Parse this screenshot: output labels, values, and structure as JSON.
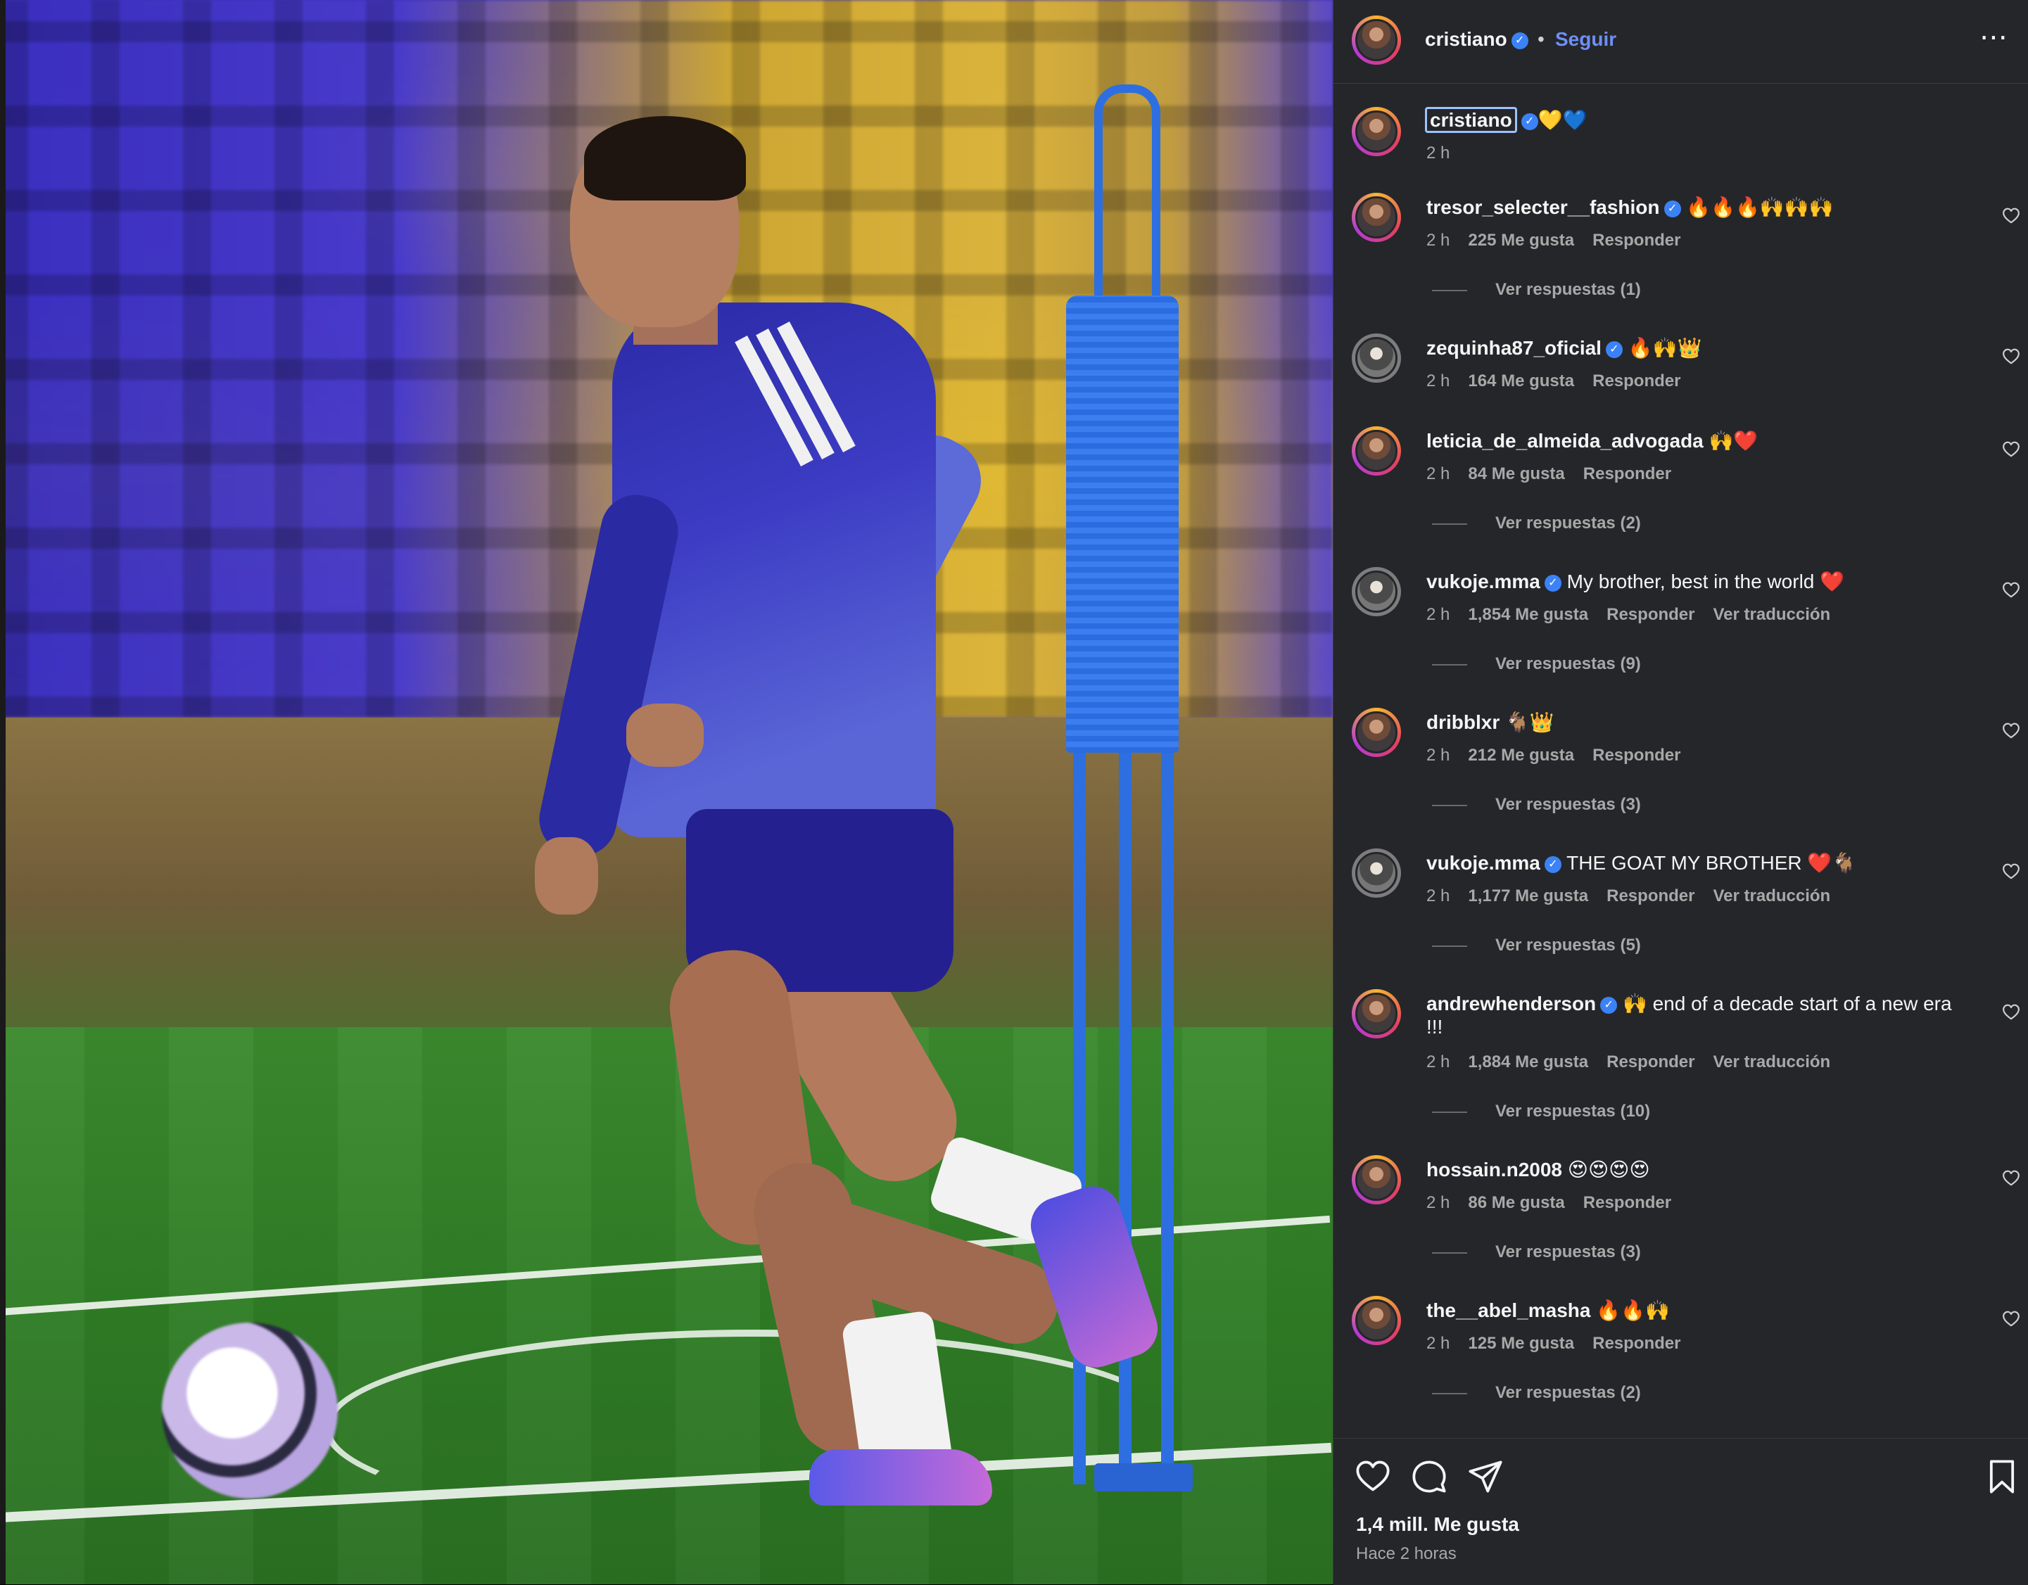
{
  "post": {
    "author": "cristiano",
    "follow_label": "Seguir",
    "dot": "•",
    "more": "⋯",
    "caption_user": "cristiano",
    "caption_text": "💛💙",
    "caption_time": "2 h"
  },
  "comments": [
    {
      "user": "tresor_selecter__fashion",
      "verified": true,
      "text": "🔥🔥🔥🙌🙌🙌",
      "time": "2 h",
      "likes": "225 Me gusta",
      "reply": "Responder",
      "translate": "",
      "replies": "Ver respuestas (1)"
    },
    {
      "user": "zequinha87_oficial",
      "verified": true,
      "text": "🔥🙌👑",
      "time": "2 h",
      "likes": "164 Me gusta",
      "reply": "Responder",
      "translate": "",
      "replies": ""
    },
    {
      "user": "leticia_de_almeida_advogada",
      "verified": false,
      "text": "🙌❤️",
      "time": "2 h",
      "likes": "84 Me gusta",
      "reply": "Responder",
      "translate": "",
      "replies": "Ver respuestas (2)"
    },
    {
      "user": "vukoje.mma",
      "verified": true,
      "text": "My brother, best in the world ❤️",
      "time": "2 h",
      "likes": "1,854 Me gusta",
      "reply": "Responder",
      "translate": "Ver traducción",
      "replies": "Ver respuestas (9)"
    },
    {
      "user": "dribblxr",
      "verified": false,
      "text": "🐐👑",
      "time": "2 h",
      "likes": "212 Me gusta",
      "reply": "Responder",
      "translate": "",
      "replies": "Ver respuestas (3)"
    },
    {
      "user": "vukoje.mma",
      "verified": true,
      "text": "THE GOAT MY BROTHER ❤️🐐",
      "time": "2 h",
      "likes": "1,177 Me gusta",
      "reply": "Responder",
      "translate": "Ver traducción",
      "replies": "Ver respuestas (5)"
    },
    {
      "user": "andrewhenderson",
      "verified": true,
      "text": "🙌 end of a decade start of a new era",
      "text2": "!!!",
      "time": "2 h",
      "likes": "1,884 Me gusta",
      "reply": "Responder",
      "translate": "Ver traducción",
      "replies": "Ver respuestas (10)"
    },
    {
      "user": "hossain.n2008",
      "verified": false,
      "text": "😍😍😍😍",
      "time": "2 h",
      "likes": "86 Me gusta",
      "reply": "Responder",
      "translate": "",
      "replies": "Ver respuestas (3)"
    },
    {
      "user": "the__abel_masha",
      "verified": false,
      "text": "🔥🔥🙌",
      "time": "2 h",
      "likes": "125 Me gusta",
      "reply": "Responder",
      "translate": "",
      "replies": "Ver respuestas (2)"
    }
  ],
  "footer": {
    "likes": "1,4 mill. Me gusta",
    "ago": "Hace 2 horas"
  },
  "icons": {
    "like": "heart-icon",
    "comment": "comment-icon",
    "share": "share-icon",
    "save": "bookmark-icon"
  },
  "colors": {
    "panel_bg": "#25262a",
    "follow": "#6e8ff5",
    "verified": "#3b82f6"
  }
}
